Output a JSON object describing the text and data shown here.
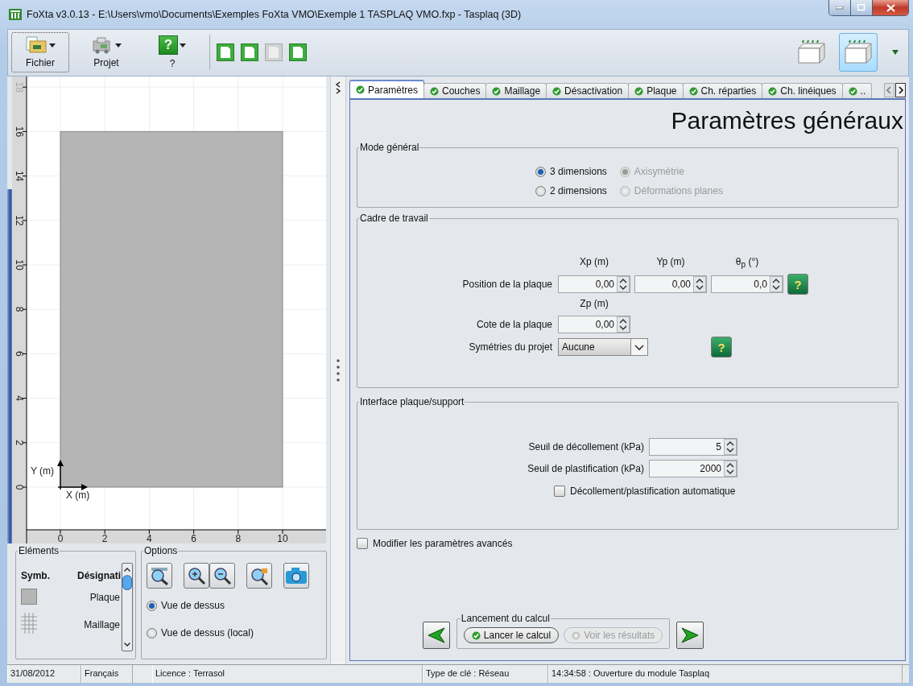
{
  "window": {
    "title": "FoXta v3.0.13 - E:\\Users\\vmo\\Documents\\Exemples FoXta VMO\\Exemple 1 TASPLAQ VMO.fxp - Tasplaq (3D)"
  },
  "toolbar": {
    "buttons": [
      {
        "kind": "file",
        "label": "Fichier",
        "focused": true
      },
      {
        "kind": "project",
        "label": "Projet",
        "focused": false
      },
      {
        "kind": "help",
        "label": "?",
        "glyph": "?",
        "focused": false
      }
    ],
    "quick_actions": [
      {
        "disabled": false
      },
      {
        "disabled": false
      },
      {
        "disabled": true
      },
      {
        "disabled": false
      }
    ],
    "view_buttons": [
      {
        "selected": false
      },
      {
        "selected": true
      }
    ]
  },
  "canvas": {
    "x_ticks": [
      "0",
      "2",
      "4",
      "6",
      "8",
      "10"
    ],
    "y_ticks": [
      "0",
      "2",
      "4",
      "6",
      "8",
      "10",
      "12",
      "14",
      "16",
      "18"
    ],
    "x_axis": "X (m)",
    "y_axis": "Y (m)"
  },
  "elements": {
    "title": "Eléments",
    "columns": [
      "Symb.",
      "Désignati"
    ],
    "rows": [
      {
        "kind": "fill",
        "label": "Plaque"
      },
      {
        "kind": "grid",
        "label": "Maillage"
      }
    ]
  },
  "options": {
    "title": "Options",
    "views": [
      {
        "label": "Vue de dessus",
        "selected": true
      },
      {
        "label": "Vue de dessus (local)",
        "selected": false
      }
    ]
  },
  "tabs": [
    {
      "label": "Paramètres",
      "selected": true
    },
    {
      "label": "Couches",
      "selected": false
    },
    {
      "label": "Maillage",
      "selected": false
    },
    {
      "label": "Désactivation",
      "selected": false
    },
    {
      "label": "Plaque",
      "selected": false
    },
    {
      "label": "Ch. réparties",
      "selected": false
    },
    {
      "label": "Ch. linéiques",
      "selected": false
    },
    {
      "label": "..",
      "selected": false
    }
  ],
  "heading": "Paramètres généraux",
  "mode_general": {
    "title": "Mode général",
    "options": [
      {
        "label": "3 dimensions",
        "selected": true,
        "disabled": false
      },
      {
        "label": "Axisymétrie",
        "selected": true,
        "disabled": true
      },
      {
        "label": "2 dimensions",
        "selected": false,
        "disabled": false
      },
      {
        "label": "Déformations planes",
        "selected": false,
        "disabled": true
      }
    ]
  },
  "cadre": {
    "title": "Cadre de travail",
    "position": {
      "label": "Position de la plaque",
      "help": "?",
      "fields": [
        {
          "header": "Xp (m)",
          "value": "0,00"
        },
        {
          "header": "Yp (m)",
          "value": "0,00"
        },
        {
          "header": "θ$_{p}$ (°)",
          "value": "0,0"
        }
      ]
    },
    "cote": {
      "label": "Cote de la plaque",
      "header": "Zp (m)",
      "value": "0,00"
    },
    "symmetry": {
      "label": "Symétries du projet",
      "value": "Aucune",
      "help": "?"
    }
  },
  "interface": {
    "title": "Interface plaque/support",
    "fields": [
      {
        "label": "Seuil de décollement (kPa)",
        "value": "5"
      },
      {
        "label": "Seuil de plastification (kPa)",
        "value": "2000"
      }
    ],
    "auto": {
      "label": "Décollement/plastification automatique",
      "checked": false
    }
  },
  "advanced": {
    "label": "Modifier les paramètres avancés",
    "checked": false
  },
  "launch": {
    "title": "Lancement du calcul",
    "buttons": [
      {
        "label": "Lancer le calcul",
        "disabled": false
      },
      {
        "label": "Voir les résultats",
        "disabled": true
      }
    ]
  },
  "status_bar": [
    "31/08/2012",
    "Français",
    "Licence : Terrasol",
    "Type de clé : Réseau",
    "14:34:58 : Ouverture du module Tasplaq"
  ]
}
